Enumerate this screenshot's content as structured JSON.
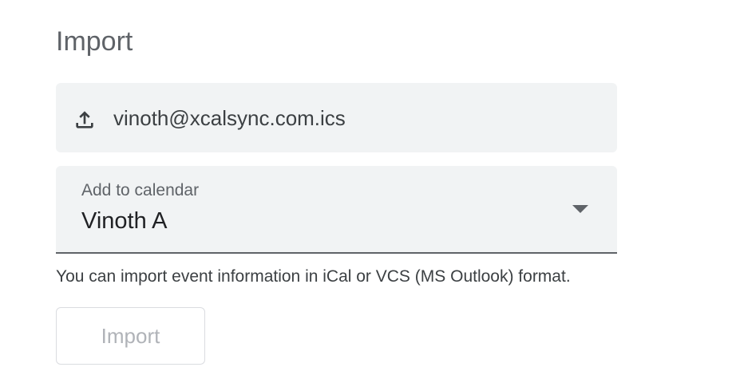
{
  "section": {
    "title": "Import"
  },
  "file_picker": {
    "icon": "upload-icon",
    "file_name": "vinoth@xcalsync.com.ics"
  },
  "calendar_select": {
    "label": "Add to calendar",
    "selected_value": "Vinoth A",
    "icon": "dropdown-arrow-icon"
  },
  "help_text": "You can import event information in iCal or VCS (MS Outlook) format.",
  "import_button": {
    "label": "Import",
    "disabled": true
  },
  "colors": {
    "field_background": "#f1f3f4",
    "title_text": "#5f6368",
    "body_text": "#3c4043",
    "disabled_text": "#b0b3b8",
    "button_border": "#dadce0"
  }
}
